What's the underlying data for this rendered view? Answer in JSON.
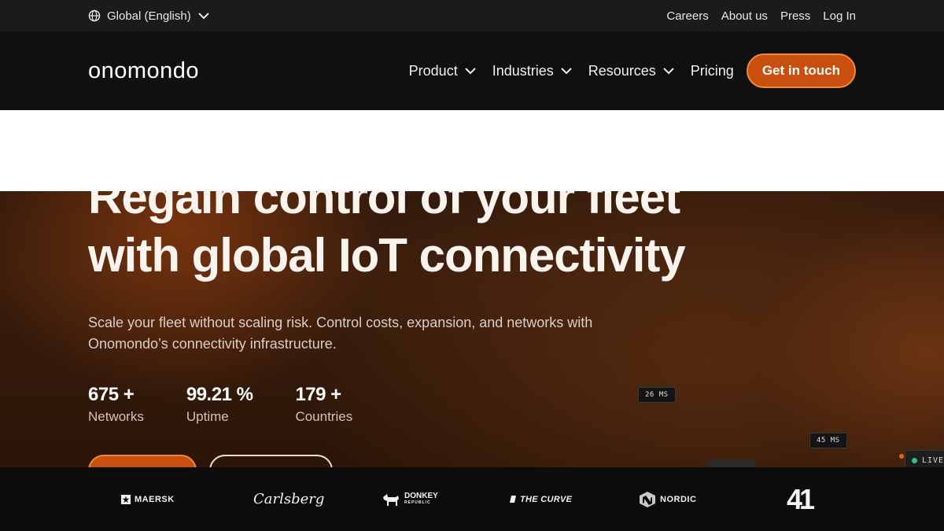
{
  "topbar": {
    "language": "Global (English)",
    "links": [
      "Careers",
      "About us",
      "Press",
      "Log In"
    ]
  },
  "nav": {
    "logo": "onomondo",
    "items": [
      {
        "label": "Product",
        "dropdown": true
      },
      {
        "label": "Industries",
        "dropdown": true
      },
      {
        "label": "Resources",
        "dropdown": true
      }
    ],
    "pricing": "Pricing",
    "cta": "Get in touch"
  },
  "hero": {
    "title_line1": "Regain control of your fleet",
    "title_line2": "with global IoT connectivity",
    "subtitle_line1": "Scale your fleet without scaling risk. Control costs, expansion, and networks with",
    "subtitle_line2": "Onomondo’s connectivity infrastructure.",
    "stats": [
      {
        "value": "675 +",
        "label": "Networks"
      },
      {
        "value": "99.21 %",
        "label": "Uptime"
      },
      {
        "value": "179 +",
        "label": "Countries"
      }
    ],
    "latency_tags": [
      "26 MS",
      "45 MS"
    ],
    "live_label": "LIVE"
  },
  "clients": {
    "maersk": "MAERSK",
    "carlsberg": "Carlsberg",
    "donkey_line1": "DONKEY",
    "donkey_line2": "REPUBLIC",
    "thecurve": "THE CURVE",
    "nordic": "NORDIC",
    "four1": "41"
  },
  "colors": {
    "accent": "#c94f0e",
    "accent_border": "#f08a3a",
    "live_green": "#35c27a"
  },
  "icons": [
    "globe-icon",
    "chevron-down-icon"
  ]
}
